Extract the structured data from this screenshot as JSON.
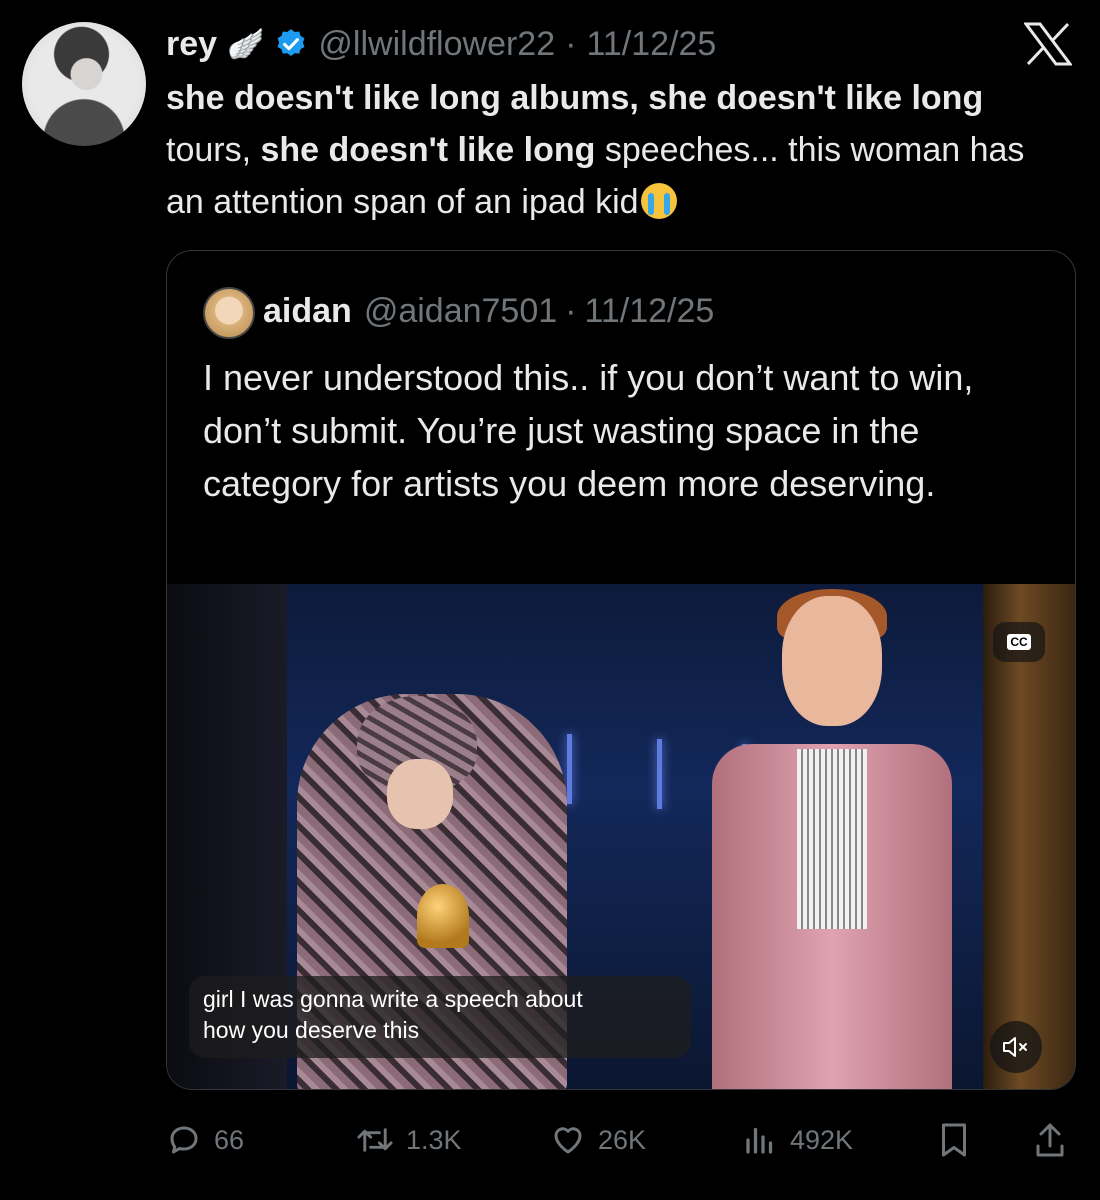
{
  "tweet": {
    "author_name": "rey",
    "author_badge_emoji": "🪽",
    "author_handle": "@llwildflower22",
    "separator": "·",
    "date": "11/12/25",
    "text_parts": [
      {
        "text": "she doesn't like long albums, she doesn't like long",
        "bold": true
      },
      {
        "text": " tours, ",
        "bold": false
      },
      {
        "text": "she doesn't like long",
        "bold": true
      },
      {
        "text": " speeches... this woman has an attention span of an ipad kid",
        "bold": false
      }
    ],
    "emoji": "😭"
  },
  "quote": {
    "author_name": "aidan",
    "author_handle": "@aidan7501",
    "separator": "·",
    "date": "11/12/25",
    "text": "I never understood this.. if you don’t want to win, don’t submit. You’re just wasting space in the category for artists you deem more deserving.",
    "video": {
      "caption_line1": "girl I was gonna write a speech about",
      "caption_line2": "how you deserve this",
      "cc_label": "CC"
    }
  },
  "actions": {
    "replies": "66",
    "reposts": "1.3K",
    "likes": "26K",
    "views": "492K"
  },
  "colors": {
    "background": "#000000",
    "text": "#e7e9ea",
    "muted": "#71767b",
    "verified": "#1d9bf0",
    "border": "#333639"
  }
}
